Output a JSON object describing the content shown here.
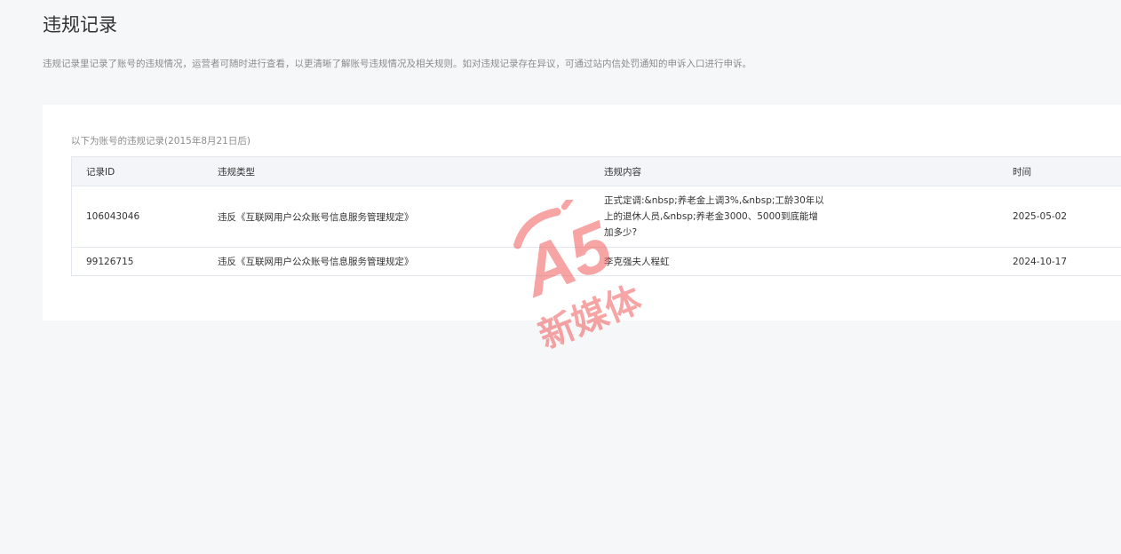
{
  "page": {
    "title": "违规记录",
    "description": "违规记录里记录了账号的违规情况，运营者可随时进行查看，以更清晰了解账号违规情况及相关规则。如对违规记录存在异议，可通过站内信处罚通知的申诉入口进行申诉。"
  },
  "panel": {
    "note": "以下为账号的违规记录(2015年8月21日后)"
  },
  "table": {
    "headers": [
      "记录ID",
      "违规类型",
      "违规内容",
      "时间"
    ],
    "rows": [
      {
        "id": "106043046",
        "type": "违反《互联网用户公众账号信息服务管理规定》",
        "content": "正式定调:&nbsp;养老金上调3%,&nbsp;工龄30年以上的退休人员,&nbsp;养老金3000、5000到底能增加多少?",
        "time": "2025-05-02"
      },
      {
        "id": "99126715",
        "type": "违反《互联网用户公众账号信息服务管理规定》",
        "content": "李克强夫人程虹",
        "time": "2024-10-17"
      }
    ]
  },
  "watermark": {
    "logo_text": "A5",
    "caption": "新媒体",
    "color": "#f05a5a"
  }
}
